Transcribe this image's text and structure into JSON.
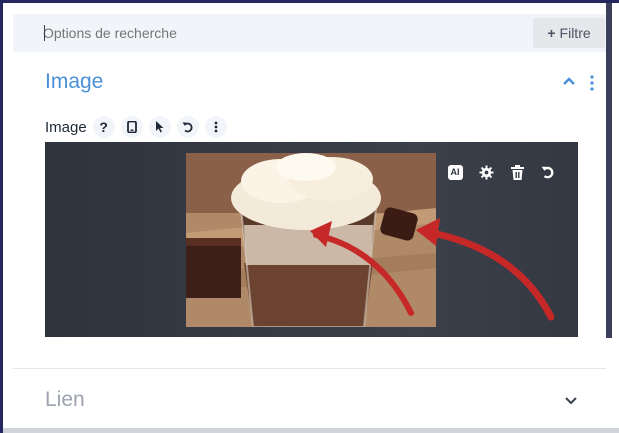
{
  "search": {
    "placeholder": "Options de recherche"
  },
  "filter": {
    "plus": "+",
    "label": "Filtre"
  },
  "image_section": {
    "title": "Image",
    "field_label": "Image",
    "icons": [
      "help-icon",
      "mobile-icon",
      "cursor-icon",
      "undo-icon",
      "more-vert-icon"
    ],
    "image_tools": [
      "ai-icon",
      "gear-icon",
      "trash-icon",
      "undo-icon"
    ],
    "ai_label": "AI",
    "toolbar_glyphs": {
      "help": "?"
    }
  },
  "link_section": {
    "title": "Lien"
  },
  "colors": {
    "accent": "#4a90d9",
    "panel": "#2e333d",
    "arrow": "#c62828"
  }
}
